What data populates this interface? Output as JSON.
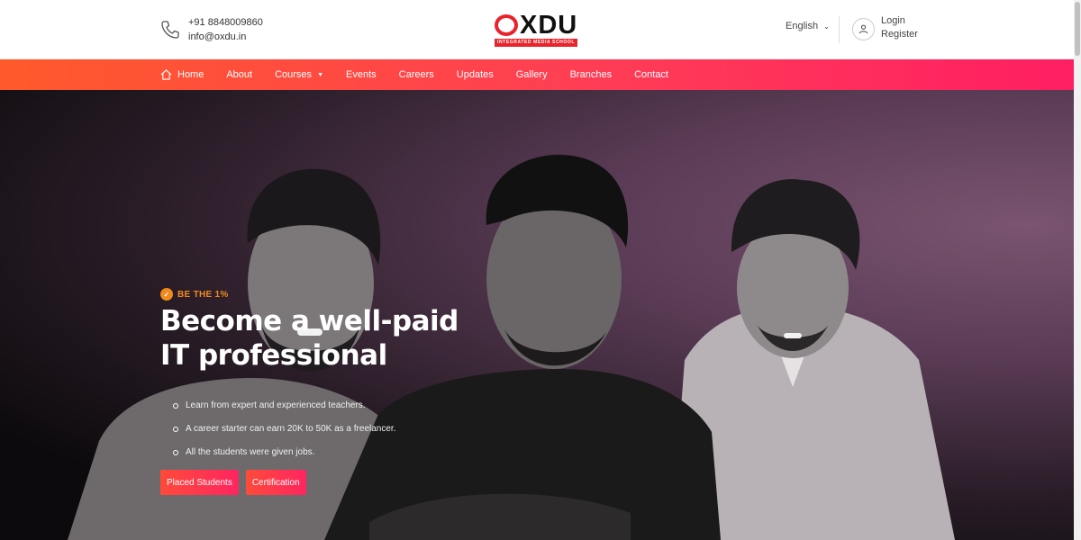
{
  "contact": {
    "phone": "+91 8848009860",
    "email": "info@oxdu.in",
    "icon": "phone-icon"
  },
  "logo": {
    "word_tail": "XDU",
    "tagline": "INTEGRATED MEDIA SCHOOL",
    "brand_color": "#e8232b"
  },
  "language": {
    "selected": "English",
    "icon": "chevron-down-icon"
  },
  "auth": {
    "login": "Login",
    "register": "Register",
    "icon": "user-icon"
  },
  "nav": {
    "items": [
      {
        "label": "Home",
        "icon": "home-icon"
      },
      {
        "label": "About"
      },
      {
        "label": "Courses",
        "icon": "caret-down-icon"
      },
      {
        "label": "Events"
      },
      {
        "label": "Careers"
      },
      {
        "label": "Updates"
      },
      {
        "label": "Gallery"
      },
      {
        "label": "Branches"
      },
      {
        "label": "Contact"
      }
    ],
    "gradient": [
      "#ff5a2b",
      "#ff1e63"
    ]
  },
  "hero": {
    "badge": "BE THE 1%",
    "headline": "Become a well-paid IT professional",
    "bullets": [
      "Learn from expert and experienced teachers.",
      "A career starter can earn 20K to 50K as a freelancer.",
      "All the students were given jobs."
    ],
    "buttons": {
      "placed": "Placed Students",
      "certification": "Certification"
    },
    "accent": "#f08a1c"
  }
}
